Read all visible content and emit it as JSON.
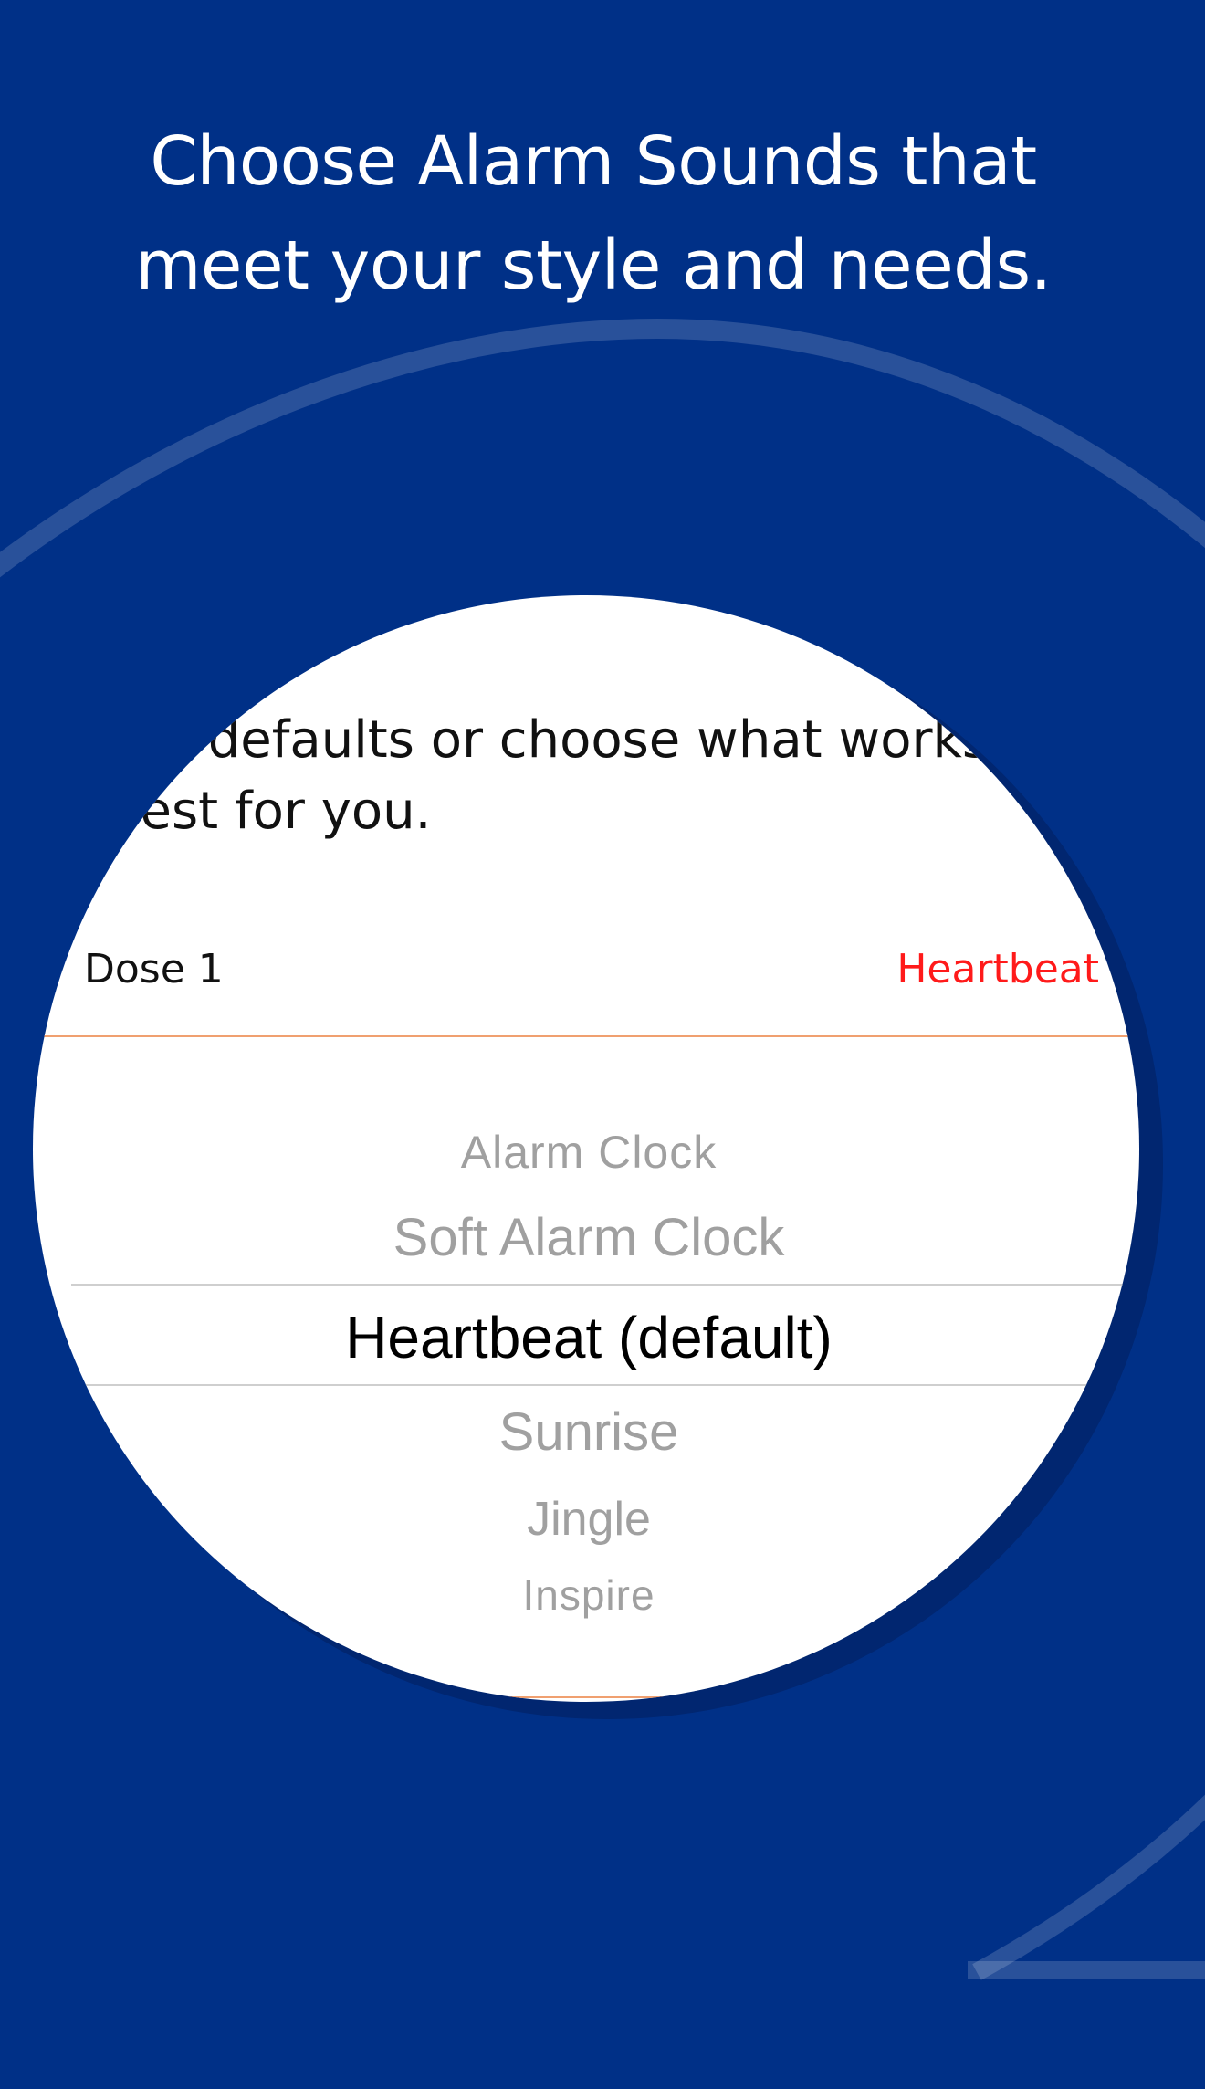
{
  "headline": {
    "line1": "Choose Alarm Sounds that",
    "line2": "meet your style and needs."
  },
  "intro": {
    "line1": "the defaults or choose what works",
    "line2": "best for you."
  },
  "dose_row": {
    "label": "Dose 1",
    "value": "Heartbeat"
  },
  "picker": {
    "items": [
      {
        "label": "Alarm Clock",
        "selected": false
      },
      {
        "label": "Soft Alarm Clock",
        "selected": false
      },
      {
        "label": "Heartbeat (default)",
        "selected": true
      },
      {
        "label": "Sunrise",
        "selected": false
      },
      {
        "label": "Jingle",
        "selected": false
      },
      {
        "label": "Inspire",
        "selected": false
      }
    ]
  },
  "colors": {
    "background": "#003087",
    "accent_red": "#ff1a1a",
    "picker_unselected": "#a0a0a0"
  }
}
